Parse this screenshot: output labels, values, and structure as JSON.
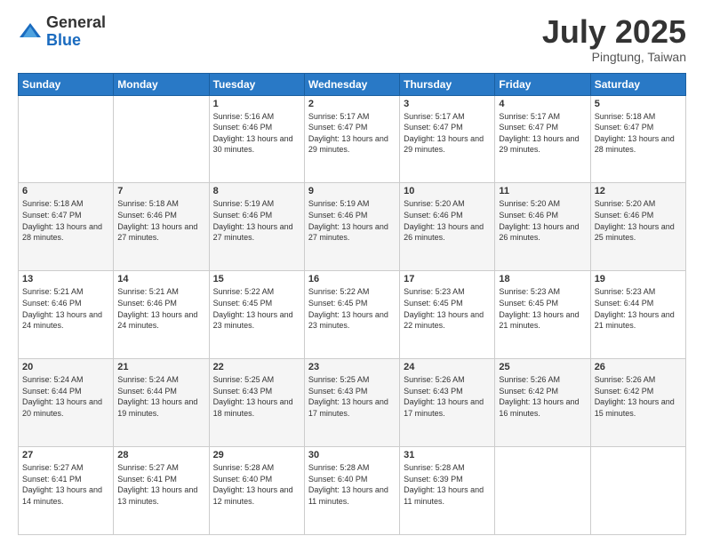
{
  "header": {
    "logo_general": "General",
    "logo_blue": "Blue",
    "month_title": "July 2025",
    "location": "Pingtung, Taiwan"
  },
  "weekdays": [
    "Sunday",
    "Monday",
    "Tuesday",
    "Wednesday",
    "Thursday",
    "Friday",
    "Saturday"
  ],
  "weeks": [
    [
      {
        "day": "",
        "info": ""
      },
      {
        "day": "",
        "info": ""
      },
      {
        "day": "1",
        "info": "Sunrise: 5:16 AM\nSunset: 6:46 PM\nDaylight: 13 hours and 30 minutes."
      },
      {
        "day": "2",
        "info": "Sunrise: 5:17 AM\nSunset: 6:47 PM\nDaylight: 13 hours and 29 minutes."
      },
      {
        "day": "3",
        "info": "Sunrise: 5:17 AM\nSunset: 6:47 PM\nDaylight: 13 hours and 29 minutes."
      },
      {
        "day": "4",
        "info": "Sunrise: 5:17 AM\nSunset: 6:47 PM\nDaylight: 13 hours and 29 minutes."
      },
      {
        "day": "5",
        "info": "Sunrise: 5:18 AM\nSunset: 6:47 PM\nDaylight: 13 hours and 28 minutes."
      }
    ],
    [
      {
        "day": "6",
        "info": "Sunrise: 5:18 AM\nSunset: 6:47 PM\nDaylight: 13 hours and 28 minutes."
      },
      {
        "day": "7",
        "info": "Sunrise: 5:18 AM\nSunset: 6:46 PM\nDaylight: 13 hours and 27 minutes."
      },
      {
        "day": "8",
        "info": "Sunrise: 5:19 AM\nSunset: 6:46 PM\nDaylight: 13 hours and 27 minutes."
      },
      {
        "day": "9",
        "info": "Sunrise: 5:19 AM\nSunset: 6:46 PM\nDaylight: 13 hours and 27 minutes."
      },
      {
        "day": "10",
        "info": "Sunrise: 5:20 AM\nSunset: 6:46 PM\nDaylight: 13 hours and 26 minutes."
      },
      {
        "day": "11",
        "info": "Sunrise: 5:20 AM\nSunset: 6:46 PM\nDaylight: 13 hours and 26 minutes."
      },
      {
        "day": "12",
        "info": "Sunrise: 5:20 AM\nSunset: 6:46 PM\nDaylight: 13 hours and 25 minutes."
      }
    ],
    [
      {
        "day": "13",
        "info": "Sunrise: 5:21 AM\nSunset: 6:46 PM\nDaylight: 13 hours and 24 minutes."
      },
      {
        "day": "14",
        "info": "Sunrise: 5:21 AM\nSunset: 6:46 PM\nDaylight: 13 hours and 24 minutes."
      },
      {
        "day": "15",
        "info": "Sunrise: 5:22 AM\nSunset: 6:45 PM\nDaylight: 13 hours and 23 minutes."
      },
      {
        "day": "16",
        "info": "Sunrise: 5:22 AM\nSunset: 6:45 PM\nDaylight: 13 hours and 23 minutes."
      },
      {
        "day": "17",
        "info": "Sunrise: 5:23 AM\nSunset: 6:45 PM\nDaylight: 13 hours and 22 minutes."
      },
      {
        "day": "18",
        "info": "Sunrise: 5:23 AM\nSunset: 6:45 PM\nDaylight: 13 hours and 21 minutes."
      },
      {
        "day": "19",
        "info": "Sunrise: 5:23 AM\nSunset: 6:44 PM\nDaylight: 13 hours and 21 minutes."
      }
    ],
    [
      {
        "day": "20",
        "info": "Sunrise: 5:24 AM\nSunset: 6:44 PM\nDaylight: 13 hours and 20 minutes."
      },
      {
        "day": "21",
        "info": "Sunrise: 5:24 AM\nSunset: 6:44 PM\nDaylight: 13 hours and 19 minutes."
      },
      {
        "day": "22",
        "info": "Sunrise: 5:25 AM\nSunset: 6:43 PM\nDaylight: 13 hours and 18 minutes."
      },
      {
        "day": "23",
        "info": "Sunrise: 5:25 AM\nSunset: 6:43 PM\nDaylight: 13 hours and 17 minutes."
      },
      {
        "day": "24",
        "info": "Sunrise: 5:26 AM\nSunset: 6:43 PM\nDaylight: 13 hours and 17 minutes."
      },
      {
        "day": "25",
        "info": "Sunrise: 5:26 AM\nSunset: 6:42 PM\nDaylight: 13 hours and 16 minutes."
      },
      {
        "day": "26",
        "info": "Sunrise: 5:26 AM\nSunset: 6:42 PM\nDaylight: 13 hours and 15 minutes."
      }
    ],
    [
      {
        "day": "27",
        "info": "Sunrise: 5:27 AM\nSunset: 6:41 PM\nDaylight: 13 hours and 14 minutes."
      },
      {
        "day": "28",
        "info": "Sunrise: 5:27 AM\nSunset: 6:41 PM\nDaylight: 13 hours and 13 minutes."
      },
      {
        "day": "29",
        "info": "Sunrise: 5:28 AM\nSunset: 6:40 PM\nDaylight: 13 hours and 12 minutes."
      },
      {
        "day": "30",
        "info": "Sunrise: 5:28 AM\nSunset: 6:40 PM\nDaylight: 13 hours and 11 minutes."
      },
      {
        "day": "31",
        "info": "Sunrise: 5:28 AM\nSunset: 6:39 PM\nDaylight: 13 hours and 11 minutes."
      },
      {
        "day": "",
        "info": ""
      },
      {
        "day": "",
        "info": ""
      }
    ]
  ]
}
